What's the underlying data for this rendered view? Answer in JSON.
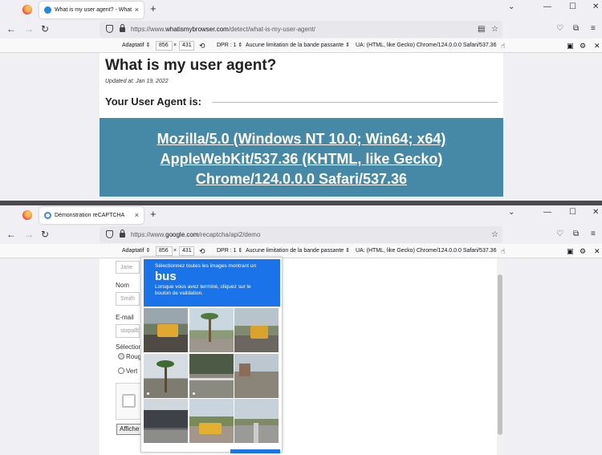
{
  "windows": [
    {
      "tab": {
        "title": "What is my user agent? - What",
        "close_glyph": "×"
      },
      "url": {
        "prefix": "https://www.",
        "host": "whatismybrowser.com",
        "path": "/detect/what-is-my-user-agent/"
      },
      "page": {
        "title": "What is my user agent?",
        "updated": "Updated at: Jan 19, 2022",
        "ua_heading": "Your User Agent is:",
        "ua_lines": [
          "Mozilla/5.0 (Windows NT 10.0; Win64; x64)",
          "AppleWebKit/537.36 (KHTML, like Gecko)",
          "Chrome/124.0.0.0 Safari/537.36"
        ]
      }
    },
    {
      "tab": {
        "title": "Démonstration reCAPTCHA",
        "close_glyph": "×"
      },
      "url": {
        "prefix": "https://www.",
        "host": "google.com",
        "path": "/recaptcha/api2/demo"
      },
      "page": {
        "first_name_placeholder": "Jane",
        "last_name_label": "Nom",
        "last_name_placeholder": "Smith",
        "email_label": "E-mail",
        "email_placeholder": "stopallb",
        "select_label": "Sélection",
        "radio1": "Roug",
        "radio2": "Vert",
        "submit_label": "Affiche",
        "captcha": {
          "instruction": "Sélectionnez toutes les images montrant un",
          "object": "bus",
          "sub": "Lorsque vous avez terminé, cliquez sur le bouton de validation."
        }
      }
    }
  ],
  "rdm": {
    "device": "Adaptatif ⇕",
    "width": "856",
    "times": "×",
    "height": "431",
    "dpr": "DPR : 1 ⇕",
    "throttle": "Aucune limitation de la bande passante ⇕",
    "ua_value": "UA: (HTML, like Gecko) Chrome/124.0.0.0 Safari/537.36"
  },
  "glyphs": {
    "new_tab": "+",
    "back": "←",
    "forward": "→",
    "reload": "↻",
    "minimize": "—",
    "maximize": "☐",
    "close": "✕",
    "chevron": "⌄",
    "menu": "≡",
    "star": "☆",
    "pocket": "♡",
    "extensions": "⧉",
    "reader": "▤",
    "touch": "☝",
    "screenshot": "▣",
    "settings": "⚙",
    "rotate": "⟲"
  },
  "colors": {
    "ua_box": "#4689a7",
    "captcha_blue": "#1a73e8",
    "tab_icon_1": "#1e88e5",
    "tab_icon_2": "#4285f4"
  }
}
